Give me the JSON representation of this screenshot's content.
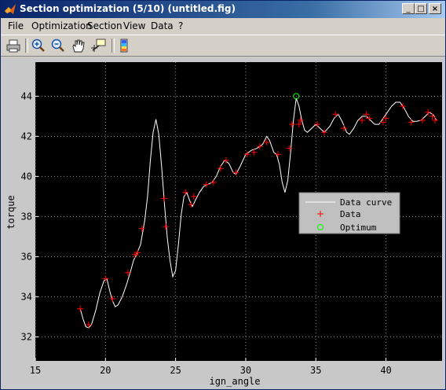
{
  "window": {
    "title": "Section optimization (5/10) (untitled.fig)"
  },
  "titlebar_buttons": [
    "_",
    "□",
    "×"
  ],
  "menu": [
    "File",
    "Optimization",
    "Section",
    "View",
    "Data",
    "?"
  ],
  "toolbar": [
    "print-icon",
    "zoom-in-icon",
    "zoom-out-icon",
    "pan-icon",
    "data-cursor-icon",
    "colorbar-icon"
  ],
  "colors": {
    "plot_bg": "#000000",
    "curve": "#ffffff",
    "data_marker": "#ff0000",
    "optimum": "#00ff00",
    "legend_bg": "#c0c0c0"
  },
  "chart_data": {
    "type": "line",
    "xlabel": "ign_angle",
    "ylabel": "torque",
    "xlim": [
      15,
      44
    ],
    "ylim": [
      30.8,
      45.7
    ],
    "xticks": [
      15,
      20,
      25,
      30,
      35,
      40
    ],
    "yticks": [
      32,
      34,
      36,
      38,
      40,
      42,
      44
    ],
    "grid": true,
    "legend_position": "right",
    "series": [
      {
        "name": "Data curve",
        "kind": "line",
        "points": [
          [
            18.2,
            33.4
          ],
          [
            18.4,
            32.9
          ],
          [
            18.6,
            32.5
          ],
          [
            18.8,
            32.45
          ],
          [
            19.0,
            32.6
          ],
          [
            19.3,
            33.3
          ],
          [
            19.6,
            34.2
          ],
          [
            19.9,
            34.8
          ],
          [
            20.1,
            34.9
          ],
          [
            20.3,
            34.3
          ],
          [
            20.5,
            33.8
          ],
          [
            20.7,
            33.5
          ],
          [
            20.9,
            33.6
          ],
          [
            21.2,
            34.0
          ],
          [
            21.5,
            34.6
          ],
          [
            21.8,
            35.3
          ],
          [
            22.0,
            35.8
          ],
          [
            22.2,
            36.1
          ],
          [
            22.5,
            36.6
          ],
          [
            22.8,
            37.8
          ],
          [
            23.0,
            39.0
          ],
          [
            23.2,
            40.8
          ],
          [
            23.4,
            42.2
          ],
          [
            23.6,
            42.85
          ],
          [
            23.8,
            42.1
          ],
          [
            24.0,
            40.5
          ],
          [
            24.2,
            38.7
          ],
          [
            24.4,
            37.0
          ],
          [
            24.6,
            35.8
          ],
          [
            24.8,
            35.0
          ],
          [
            25.0,
            35.3
          ],
          [
            25.2,
            36.6
          ],
          [
            25.4,
            38.1
          ],
          [
            25.6,
            39.0
          ],
          [
            25.8,
            39.2
          ],
          [
            26.0,
            38.8
          ],
          [
            26.2,
            38.5
          ],
          [
            26.4,
            38.8
          ],
          [
            26.7,
            39.2
          ],
          [
            27.0,
            39.5
          ],
          [
            27.3,
            39.6
          ],
          [
            27.6,
            39.7
          ],
          [
            27.9,
            40.0
          ],
          [
            28.2,
            40.5
          ],
          [
            28.5,
            40.8
          ],
          [
            28.8,
            40.65
          ],
          [
            29.1,
            40.2
          ],
          [
            29.3,
            40.1
          ],
          [
            29.6,
            40.5
          ],
          [
            30.0,
            41.1
          ],
          [
            30.4,
            41.3
          ],
          [
            30.8,
            41.4
          ],
          [
            31.2,
            41.6
          ],
          [
            31.5,
            42.0
          ],
          [
            31.7,
            41.8
          ],
          [
            32.0,
            41.2
          ],
          [
            32.2,
            41.1
          ],
          [
            32.4,
            40.6
          ],
          [
            32.6,
            39.7
          ],
          [
            32.8,
            39.2
          ],
          [
            33.0,
            39.8
          ],
          [
            33.2,
            41.2
          ],
          [
            33.4,
            42.8
          ],
          [
            33.6,
            43.9
          ],
          [
            33.8,
            43.5
          ],
          [
            34.0,
            42.8
          ],
          [
            34.2,
            42.3
          ],
          [
            34.4,
            42.2
          ],
          [
            34.7,
            42.4
          ],
          [
            35.0,
            42.6
          ],
          [
            35.3,
            42.4
          ],
          [
            35.6,
            42.2
          ],
          [
            36.0,
            42.5
          ],
          [
            36.3,
            42.9
          ],
          [
            36.6,
            43.1
          ],
          [
            36.9,
            42.7
          ],
          [
            37.2,
            42.2
          ],
          [
            37.4,
            42.1
          ],
          [
            37.7,
            42.4
          ],
          [
            38.0,
            42.8
          ],
          [
            38.3,
            43.0
          ],
          [
            38.6,
            43.0
          ],
          [
            38.9,
            42.8
          ],
          [
            39.2,
            42.6
          ],
          [
            39.5,
            42.6
          ],
          [
            39.8,
            42.9
          ],
          [
            40.1,
            43.2
          ],
          [
            40.4,
            43.5
          ],
          [
            40.7,
            43.7
          ],
          [
            41.0,
            43.7
          ],
          [
            41.3,
            43.4
          ],
          [
            41.6,
            43.0
          ],
          [
            41.9,
            42.75
          ],
          [
            42.2,
            42.75
          ],
          [
            42.5,
            42.8
          ],
          [
            42.8,
            43.0
          ],
          [
            43.1,
            43.2
          ],
          [
            43.4,
            43.05
          ],
          [
            43.6,
            42.8
          ]
        ]
      },
      {
        "name": "Data",
        "kind": "marker",
        "points": [
          [
            18.2,
            33.4
          ],
          [
            18.8,
            32.6
          ],
          [
            20.0,
            34.9
          ],
          [
            20.5,
            33.9
          ],
          [
            21.6,
            35.2
          ],
          [
            22.1,
            36.1
          ],
          [
            22.3,
            36.2
          ],
          [
            22.6,
            37.4
          ],
          [
            24.2,
            38.9
          ],
          [
            24.3,
            37.5
          ],
          [
            25.7,
            39.2
          ],
          [
            26.1,
            38.6
          ],
          [
            26.3,
            39.0
          ],
          [
            27.2,
            39.6
          ],
          [
            27.7,
            39.7
          ],
          [
            28.2,
            40.4
          ],
          [
            28.6,
            40.8
          ],
          [
            29.3,
            40.2
          ],
          [
            30.1,
            41.1
          ],
          [
            30.6,
            41.2
          ],
          [
            31.0,
            41.5
          ],
          [
            31.5,
            41.7
          ],
          [
            32.3,
            41.1
          ],
          [
            33.1,
            41.4
          ],
          [
            33.3,
            42.6
          ],
          [
            33.8,
            42.6
          ],
          [
            33.9,
            42.8
          ],
          [
            35.1,
            42.6
          ],
          [
            35.6,
            42.2
          ],
          [
            36.4,
            43.1
          ],
          [
            37.0,
            42.4
          ],
          [
            38.3,
            42.8
          ],
          [
            38.6,
            43.1
          ],
          [
            38.8,
            42.9
          ],
          [
            39.8,
            42.7
          ],
          [
            40.0,
            42.9
          ],
          [
            41.2,
            43.5
          ],
          [
            41.8,
            42.7
          ],
          [
            42.6,
            42.8
          ],
          [
            43.0,
            43.2
          ],
          [
            43.3,
            43.0
          ],
          [
            43.5,
            42.8
          ]
        ]
      },
      {
        "name": "Optimum",
        "kind": "marker",
        "points": [
          [
            33.6,
            44.0
          ]
        ]
      }
    ]
  }
}
